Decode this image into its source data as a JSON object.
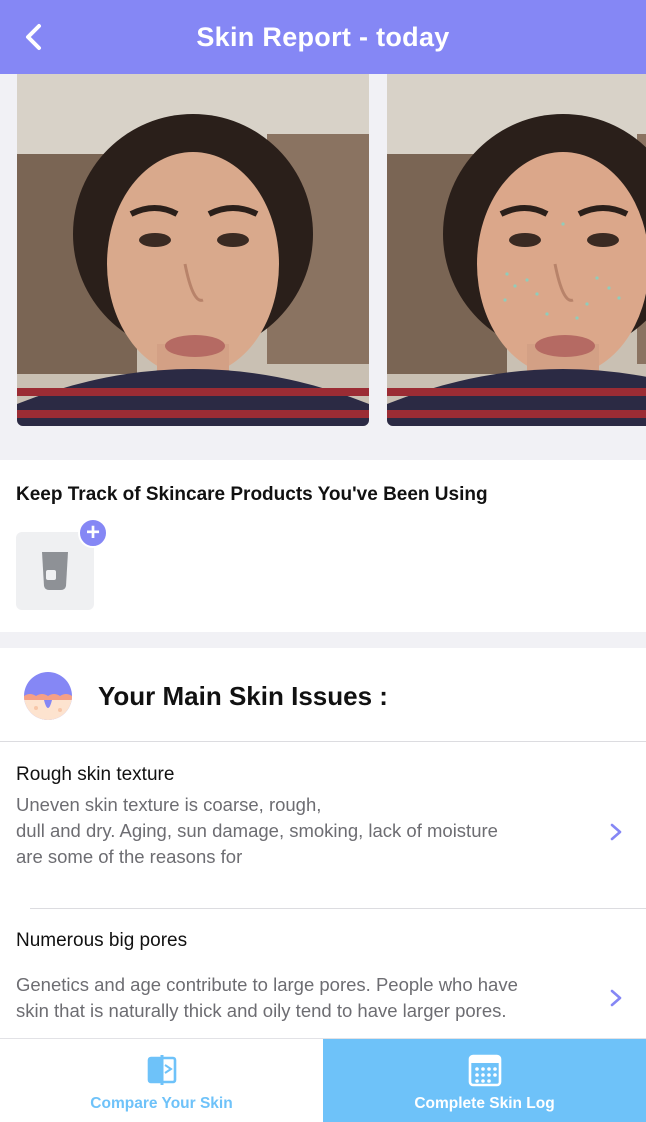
{
  "header": {
    "title": "Skin Report - today"
  },
  "products": {
    "heading": "Keep Track of Skincare Products You've Been Using",
    "add_symbol": "+"
  },
  "issues": {
    "heading": "Your Main Skin Issues :",
    "items": [
      {
        "name": "Rough skin texture",
        "desc_lines": [
          "Uneven skin texture is coarse, rough,",
          "dull and dry. Aging, sun damage, smoking, lack of moisture",
          "are some of the reasons for"
        ]
      },
      {
        "name": "Numerous big pores",
        "desc_lines": [
          "Genetics and age contribute to large pores. People who have",
          "skin that is naturally thick and oily tend to have larger pores."
        ]
      }
    ]
  },
  "tabs": {
    "compare": "Compare Your Skin",
    "log": "Complete Skin Log"
  },
  "colors": {
    "accent": "#8587f5",
    "tab_blue": "#6ec2f9"
  },
  "icons": {
    "back": "chevron-left-icon",
    "product": "skincare-tube-icon",
    "issue_badge": "skin-layer-icon",
    "compare": "compare-book-icon",
    "log": "calendar-icon"
  }
}
